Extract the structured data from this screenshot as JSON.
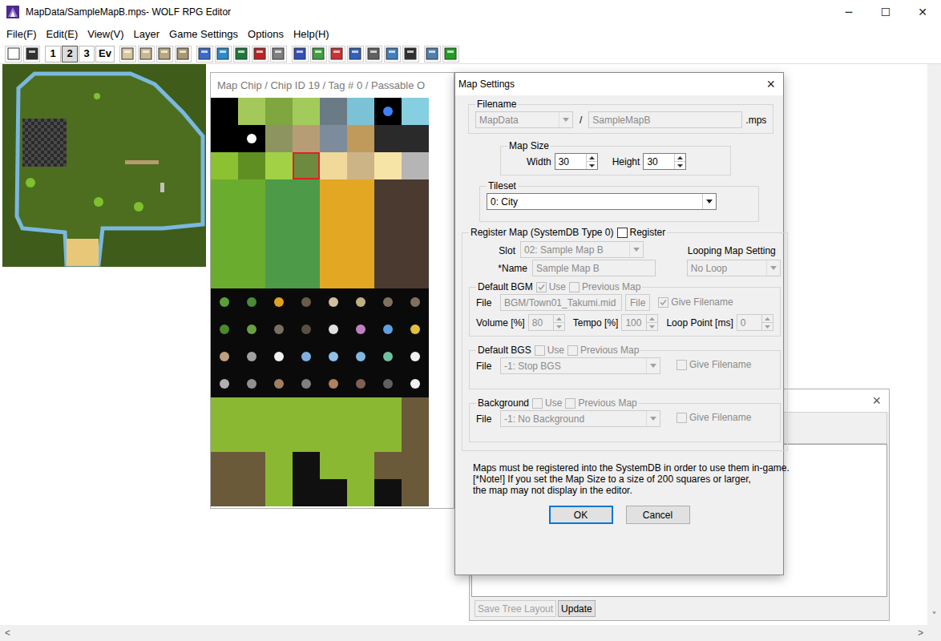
{
  "window": {
    "title": "MapData/SampleMapB.mps- WOLF RPG Editor",
    "controls": [
      "─",
      "☐",
      "✕"
    ]
  },
  "menu": [
    "File(F)",
    "Edit(E)",
    "View(V)",
    "Layer",
    "Game Settings",
    "Options",
    "Help(H)"
  ],
  "toolbar": {
    "layers": [
      {
        "label": "1",
        "selected": false
      },
      {
        "label": "2",
        "selected": true
      },
      {
        "label": "3",
        "selected": false
      },
      {
        "label": "Ev",
        "selected": false
      }
    ]
  },
  "map_chip": {
    "title": "Map Chip / Chip ID 19 / Tag # 0 / Passable O",
    "selected_index": 19
  },
  "map_settings": {
    "title": "Map Settings",
    "close": "×",
    "filename": {
      "label": "Filename",
      "folder": "MapData",
      "separator": "/",
      "name": "SampleMapB",
      "ext": ".mps",
      "disabled": true
    },
    "map_size": {
      "label": "Map Size",
      "width_label": "Width",
      "width": "30",
      "height_label": "Height",
      "height": "30"
    },
    "tileset": {
      "label": "Tileset",
      "value": "0: City"
    },
    "register": {
      "label": "Register Map (SystemDB Type 0)",
      "checkbox": "Register",
      "checked": false,
      "slot_label": "Slot",
      "slot": "02: Sample Map B",
      "name_label": "*Name",
      "name": "Sample Map B",
      "loop_label": "Looping Map Setting",
      "loop": "No Loop"
    },
    "bgm": {
      "label": "Default BGM",
      "use": {
        "label": "Use",
        "checked": true
      },
      "previous": {
        "label": "Previous Map",
        "checked": false
      },
      "file_label": "File",
      "file": "BGM/Town01_Takumi.mid",
      "file_button": "File",
      "give": {
        "label": "Give Filename",
        "checked": true
      },
      "volume_label": "Volume [%]",
      "volume": "80",
      "tempo_label": "Tempo [%]",
      "tempo": "100",
      "loop_label": "Loop Point [ms]",
      "loop": "0"
    },
    "bgs": {
      "label": "Default BGS",
      "use": {
        "label": "Use",
        "checked": false
      },
      "previous": {
        "label": "Previous Map",
        "checked": false
      },
      "file_label": "File",
      "file": "-1: Stop BGS",
      "give": {
        "label": "Give Filename",
        "checked": false
      }
    },
    "background": {
      "label": "Background",
      "use": {
        "label": "Use",
        "checked": false
      },
      "previous": {
        "label": "Previous Map",
        "checked": false
      },
      "file_label": "File",
      "file": "-1: No Background",
      "give": {
        "label": "Give Filename",
        "checked": false
      }
    },
    "notes": [
      "Maps must be registered into the SystemDB in order to use them in-game.",
      "[*Note!] If you set the Map Size to a size of 200 squares or larger,",
      "the map may not display in the editor."
    ],
    "buttons": [
      {
        "label": "OK",
        "default": true
      },
      {
        "label": "Cancel",
        "default": false
      }
    ]
  },
  "back_window": {
    "close": "×",
    "buttons": [
      {
        "label": "Save Tree Layout",
        "disabled": true
      },
      {
        "label": "Update",
        "disabled": false
      }
    ]
  },
  "scrollbar": {
    "left": "<",
    "right": ">",
    "down": "˅"
  }
}
